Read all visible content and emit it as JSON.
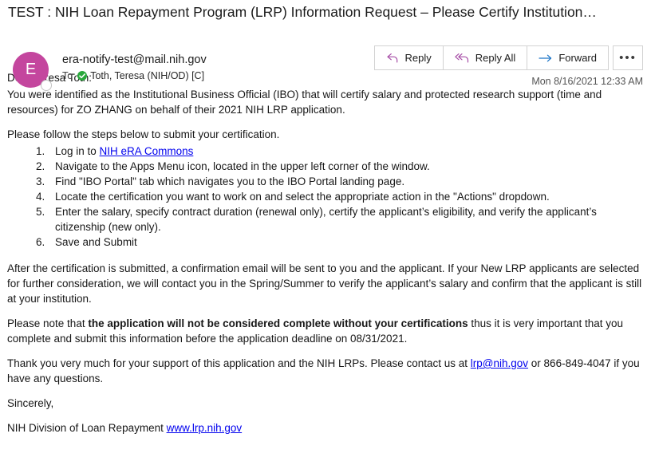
{
  "email": {
    "subject": "TEST : NIH Loan Repayment Program (LRP) Information Request – Please Certify Institution…",
    "sender": "era-notify-test@mail.nih.gov",
    "to_label": "To",
    "recipient": "Toth, Teresa (NIH/OD) [C]",
    "avatar_initial": "E",
    "avatar_color": "#C4469E",
    "timestamp": "Mon 8/16/2021 12:33 AM"
  },
  "toolbar": {
    "reply_label": "Reply",
    "reply_all_label": "Reply All",
    "forward_label": "Forward",
    "more_label": "•••",
    "reply_icon_color": "#A64CA6",
    "forward_icon_color": "#1E76C8"
  },
  "body": {
    "greeting": "Dear Teresa Toth:",
    "intro": "You were identified as the Institutional Business Official (IBO) that will certify salary and protected research support (time and resources) for ZO ZHANG on behalf of their 2021 NIH LRP application.",
    "steps_intro": "Please follow the steps below to submit your certification.",
    "steps": [
      {
        "prefix": "Log in to ",
        "link_text": "NIH eRA Commons",
        "suffix": ""
      },
      {
        "prefix": "Navigate to the Apps Menu icon, located in the upper left corner of the window.",
        "link_text": "",
        "suffix": ""
      },
      {
        "prefix": "Find \"IBO Portal\" tab which navigates you to the IBO Portal landing page.",
        "link_text": "",
        "suffix": ""
      },
      {
        "prefix": "Locate the certification you want to work on and select the appropriate action in the \"Actions\" dropdown.",
        "link_text": "",
        "suffix": ""
      },
      {
        "prefix": "Enter the salary, specify contract duration (renewal only), certify the applicant’s eligibility, and verify the applicant’s citizenship (new only).",
        "link_text": "",
        "suffix": ""
      },
      {
        "prefix": "Save and Submit",
        "link_text": "",
        "suffix": ""
      }
    ],
    "after_cert": "After the certification is submitted, a confirmation email will be sent to you and the applicant. If your New LRP applicants are selected for further consideration, we will contact you in the Spring/Summer to verify the applicant’s salary and confirm that the applicant is still at your institution.",
    "note_prefix": "Please note that ",
    "note_bold": "the application will not be considered complete without your certifications",
    "note_suffix": " thus it is very important that you complete and submit this information before the application deadline on 08/31/2021.",
    "thanks_prefix": "Thank you very much for your support of this application and the NIH LRPs. Please contact us at ",
    "thanks_link": "lrp@nih.gov",
    "thanks_suffix": " or 866-849-4047 if you have any questions.",
    "sign_off": "Sincerely,",
    "signature_prefix": "NIH Division of Loan Repayment ",
    "signature_link": "www.lrp.nih.gov"
  }
}
